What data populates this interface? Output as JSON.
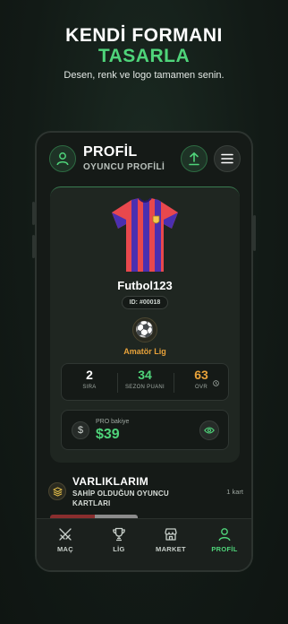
{
  "promo": {
    "title_line1": "KENDİ FORMANI",
    "title_line2": "TASARLA",
    "subtitle": "Desen, renk ve logo tamamen senin."
  },
  "header": {
    "title": "PROFİL",
    "subtitle": "OYUNCU PROFİLİ",
    "icons": {
      "avatar": "user-icon",
      "upload": "upload-icon",
      "menu": "menu-icon"
    }
  },
  "profile": {
    "username": "Futbol123",
    "player_id": "ID: #00018",
    "league": "Amatör Lig",
    "league_icon": "soccer-ball-icon",
    "jersey_colors": {
      "primary": "#e8484d",
      "stripe": "#4b2fb0",
      "crest": "#f2c94c"
    }
  },
  "stats": [
    {
      "value": "2",
      "label": "SIRA",
      "color": "#ffffff"
    },
    {
      "value": "34",
      "label": "SEZON PUANI",
      "color": "#4fd47a"
    },
    {
      "value": "63",
      "label": "OVR",
      "color": "#e8a23a"
    }
  ],
  "balance": {
    "label": "PRO bakiye",
    "value": "$39",
    "icon": "dollar-icon",
    "toggle_icon": "eye-icon"
  },
  "assets": {
    "title": "VARLIKLARIM",
    "subtitle": "SAHİP OLDUĞUN OYUNCU KARTLARI",
    "count": "1 kart",
    "icon": "layers-icon"
  },
  "tabs": [
    {
      "label": "MAÇ",
      "icon": "swords-icon",
      "active": false
    },
    {
      "label": "LİG",
      "icon": "trophy-icon",
      "active": false
    },
    {
      "label": "MARKET",
      "icon": "store-icon",
      "active": false
    },
    {
      "label": "PROFİL",
      "icon": "user-icon",
      "active": true
    }
  ],
  "colors": {
    "accent": "#4fd47a",
    "gold": "#e8a23a",
    "background": "#151a17"
  }
}
